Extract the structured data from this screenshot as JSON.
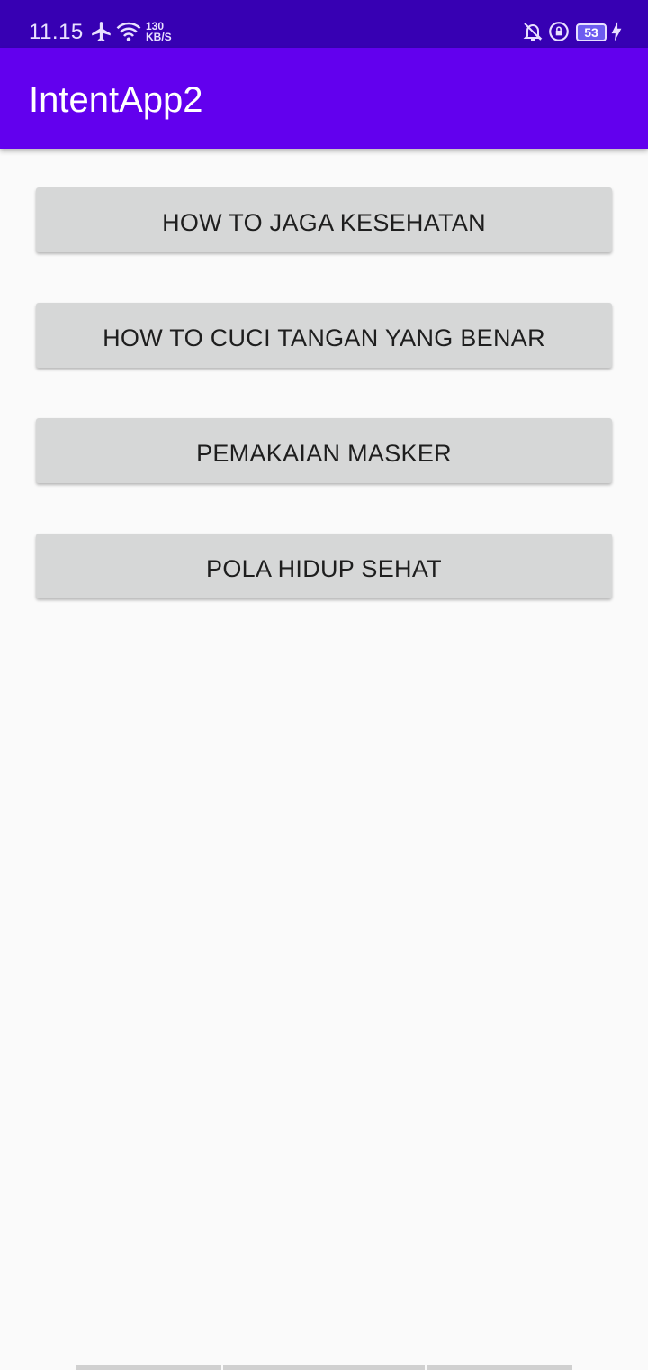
{
  "status_bar": {
    "time": "11.15",
    "net_speed_value": "130",
    "net_speed_unit": "KB/S",
    "battery": "53",
    "icons": [
      "airplane-icon",
      "wifi-icon",
      "bell-off-icon",
      "rotation-lock-icon",
      "battery-icon",
      "charging-icon"
    ]
  },
  "app_bar": {
    "title": "IntentApp2",
    "color": "#6200ee",
    "status_color": "#3700b3"
  },
  "buttons": [
    {
      "label": "HOW TO JAGA KESEHATAN"
    },
    {
      "label": "HOW TO CUCI TANGAN YANG BENAR"
    },
    {
      "label": "PEMAKAIAN MASKER"
    },
    {
      "label": "POLA HIDUP SEHAT"
    }
  ]
}
